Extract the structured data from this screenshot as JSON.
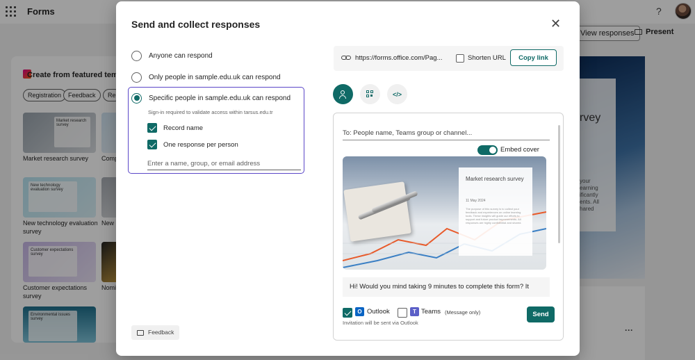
{
  "app": {
    "name": "Forms",
    "help_icon": "help-icon",
    "view_responses_label": "View responses",
    "present_label": "Present"
  },
  "background": {
    "panel_title": "Create from featured templates",
    "chips": [
      "Registration",
      "Feedback",
      "Re"
    ],
    "thumbnails": [
      {
        "card_text": "Market research survey",
        "label": "Market research survey"
      },
      {
        "card_text": "",
        "label": "Comp"
      },
      {
        "card_text": "New technology evaluation survey",
        "label": "New technology evaluation survey"
      },
      {
        "card_text": "",
        "label": "New p"
      },
      {
        "card_text": "Customer expectations survey",
        "label": "Customer expectations survey"
      },
      {
        "card_text": "",
        "label": "Nomi"
      },
      {
        "card_text": "Environmental issues survey",
        "label": ""
      }
    ],
    "right_preview_title": "rvey",
    "right_preview_text": "your earning ificantly ents. All hared"
  },
  "dialog": {
    "title": "Send and collect responses",
    "close_icon": "close-icon",
    "options": [
      {
        "label": "Anyone can respond",
        "checked": false
      },
      {
        "label": "Only people in sample.edu.uk can respond",
        "checked": false
      },
      {
        "label": "Specific people in sample.edu.uk can respond",
        "checked": true
      }
    ],
    "signin_hint": "Sign-in required to validate access within tarsus.edu.tr",
    "record_name_label": "Record name",
    "record_name_checked": true,
    "one_response_label": "One response per person",
    "one_response_checked": true,
    "people_placeholder": "Enter a name, group, or email address",
    "feedback_label": "Feedback",
    "link": {
      "url": "https://forms.office.com/Pag...",
      "shorten_label": "Shorten URL",
      "shorten_checked": false,
      "copy_label": "Copy link"
    },
    "share_tabs": [
      {
        "name": "invite-people",
        "icon": "person-add-icon",
        "active": true
      },
      {
        "name": "qr-code",
        "icon": "qr-code-icon",
        "active": false
      },
      {
        "name": "embed",
        "icon": "code-icon",
        "active": false,
        "glyph": "</>"
      }
    ],
    "compose": {
      "to_placeholder": "To: People name, Teams group or channel...",
      "embed_cover_label": "Embed cover",
      "embed_cover_on": true,
      "cover": {
        "title": "Market research survey",
        "date": "11 May 2024",
        "body": "The purpose of this survey is to collect your feedback and experiences on online learning tools. These insights will guide our efforts to support and future product improvements. All responses are highly confidential and shared."
      },
      "message": "Hi! Would you mind taking 9 minutes to complete this form? It",
      "outlook_label": "Outlook",
      "outlook_checked": true,
      "teams_label": "Teams",
      "teams_sub": "(Message only)",
      "teams_checked": false,
      "invite_note": "Invitation will be sent via Outlook",
      "send_label": "Send"
    }
  },
  "colors": {
    "accent": "#0f6a66",
    "focus_border": "#5b47c8",
    "overlay": "rgba(0,0,0,0.38)"
  }
}
